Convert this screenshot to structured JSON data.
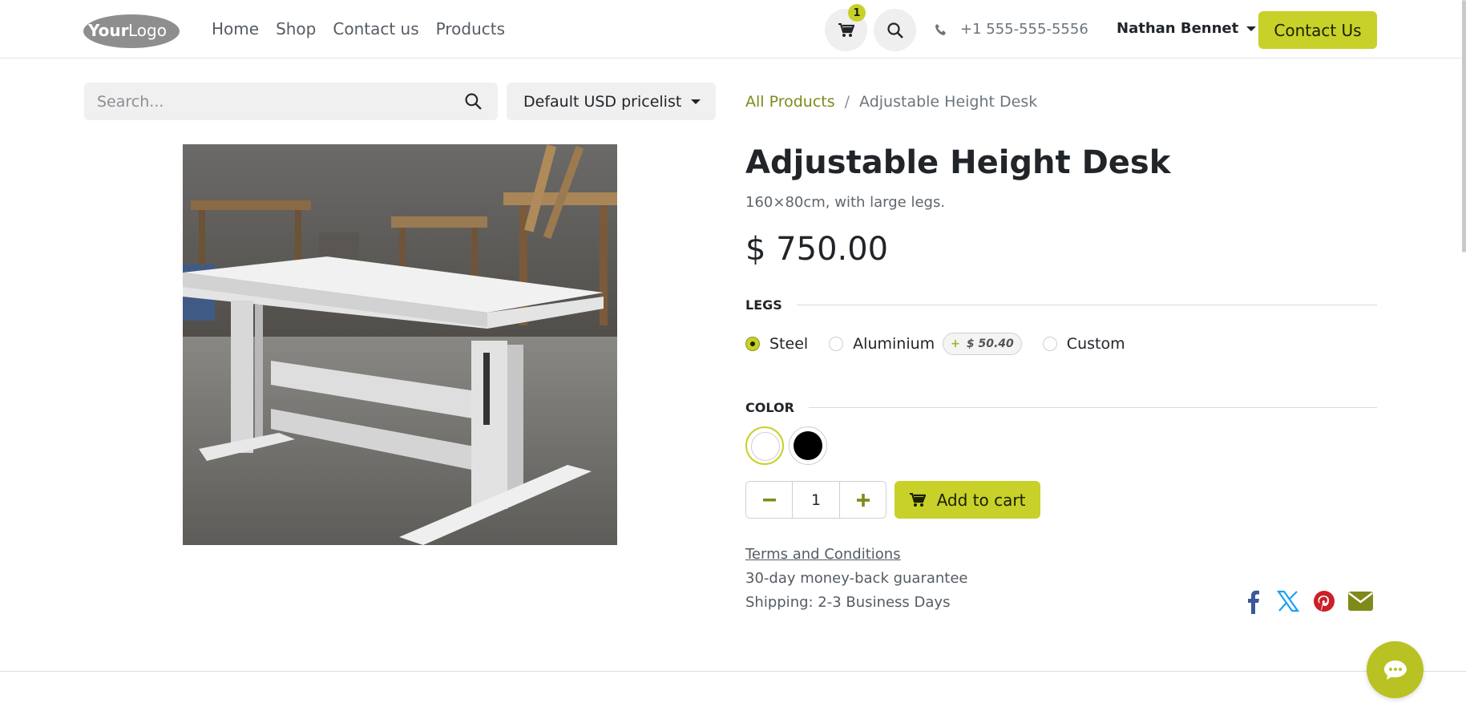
{
  "header": {
    "logo_text": "YourLogo",
    "nav": [
      "Home",
      "Shop",
      "Contact us",
      "Products"
    ],
    "cart_count": "1",
    "phone": "+1 555-555-5556",
    "user_name": "Nathan Bennet",
    "contact_button": "Contact Us"
  },
  "search": {
    "placeholder": "Search...",
    "pricelist": "Default USD pricelist"
  },
  "breadcrumb": {
    "link": "All Products",
    "separator": "/",
    "current": "Adjustable Height Desk"
  },
  "product": {
    "title": "Adjustable Height Desk",
    "subtitle": "160×80cm, with large legs.",
    "price": "$ 750.00",
    "legs_label": "LEGS",
    "legs_options": [
      {
        "label": "Steel",
        "checked": true
      },
      {
        "label": "Aluminium",
        "checked": false,
        "extra": "$ 50.40",
        "extra_sign": "+"
      },
      {
        "label": "Custom",
        "checked": false
      }
    ],
    "color_label": "COLOR",
    "colors": [
      "#ffffff",
      "#000000"
    ],
    "quantity": "1",
    "add_to_cart": "Add to cart",
    "terms": "Terms and Conditions",
    "guarantee": "30-day money-back guarantee",
    "shipping": "Shipping: 2-3 Business Days"
  },
  "colors": {
    "accent": "#c7d129",
    "accent_dark": "#7f8a1a",
    "facebook": "#3b5998",
    "twitter": "#1da1f2",
    "pinterest": "#cb2027",
    "email": "#7f8a1a"
  }
}
